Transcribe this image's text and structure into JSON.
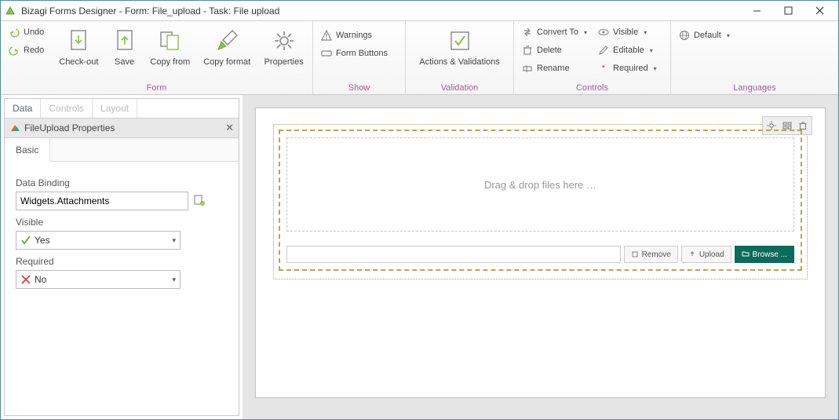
{
  "title": "Bizagi Forms Designer  - Form: File_upload - Task:  File upload",
  "ribbon": {
    "undo": "Undo",
    "redo": "Redo",
    "checkout": "Check-out",
    "save": "Save",
    "copyfrom": "Copy from",
    "copyformat": "Copy format",
    "properties": "Properties",
    "groups": {
      "form": "Form",
      "show": "Show",
      "validation": "Validation",
      "controls": "Controls",
      "languages": "Languages"
    },
    "warnings": "Warnings",
    "formbuttons": "Form Buttons",
    "actions": "Actions & Validations",
    "convert": "Convert To",
    "delete": "Delete",
    "rename": "Rename",
    "visible": "Visible",
    "editable": "Editable",
    "required": "Required",
    "default": "Default"
  },
  "panel": {
    "tabs": {
      "data": "Data",
      "controls": "Controls",
      "layout": "Layout"
    },
    "header": "FileUpload Properties",
    "basic": "Basic",
    "binding_label": "Data Binding",
    "binding_value": "Widgets.Attachments",
    "visible_label": "Visible",
    "visible_value": "Yes",
    "required_label": "Required",
    "required_value": "No"
  },
  "canvas": {
    "dropzone": "Drag & drop files here …",
    "remove": "Remove",
    "upload": "Upload",
    "browse": "Browse ..."
  }
}
